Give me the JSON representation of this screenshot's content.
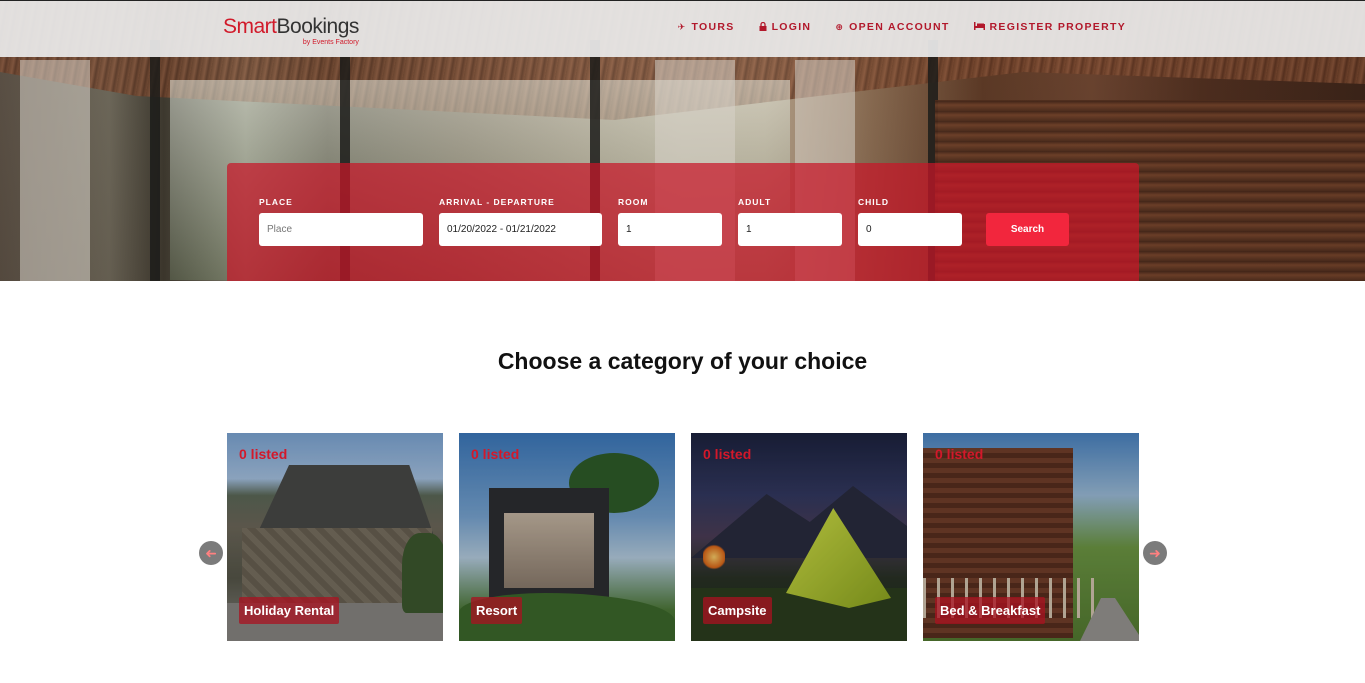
{
  "navbar": {
    "logo": {
      "smart": "Smart",
      "bookings": "Bookings",
      "subtitle": "by Events Factory"
    },
    "links": [
      {
        "label": "TOURS",
        "icon": "plane-icon",
        "glyph": "✈"
      },
      {
        "label": "LOGIN",
        "icon": "lock-icon",
        "glyph": "🔒"
      },
      {
        "label": "OPEN ACCOUNT",
        "icon": "plus-circle-icon",
        "glyph": "⊕"
      },
      {
        "label": "REGISTER PROPERTY",
        "icon": "bed-icon",
        "glyph": "▬"
      }
    ]
  },
  "search": {
    "place": {
      "label": "PLACE",
      "placeholder": "Place",
      "value": ""
    },
    "dates": {
      "label": "ARRIVAL - DEPARTURE",
      "value": "01/20/2022 - 01/21/2022"
    },
    "room": {
      "label": "ROOM",
      "value": "1"
    },
    "adult": {
      "label": "ADULT",
      "value": "1"
    },
    "child": {
      "label": "CHILD",
      "value": "0"
    },
    "button_label": "Search"
  },
  "categories": {
    "title": "Choose a category of your choice",
    "prev_glyph": "➜",
    "next_glyph": "➜",
    "items": [
      {
        "count": "0 listed",
        "name": "Holiday Rental"
      },
      {
        "count": "0 listed",
        "name": "Resort"
      },
      {
        "count": "0 listed",
        "name": "Campsite"
      },
      {
        "count": "0 listed",
        "name": "Bed & Breakfast"
      }
    ]
  },
  "colors": {
    "brand_red": "#d11a2a",
    "search_button": "#f2263d",
    "panel_overlay": "rgba(200,22,40,0.72)"
  }
}
